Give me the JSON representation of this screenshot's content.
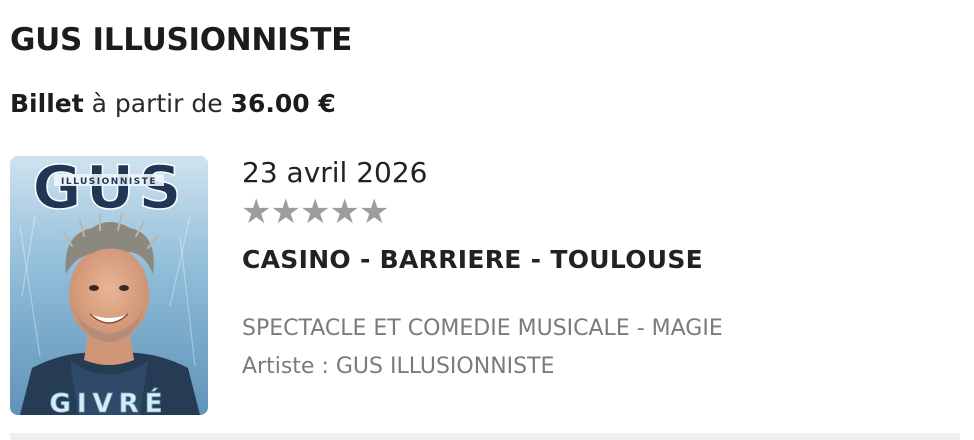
{
  "event": {
    "title": "GUS ILLUSIONNISTE",
    "price": {
      "label_strong": "Billet",
      "label_light": "à partir de",
      "amount": "36.00 €"
    },
    "date": "23 avril 2026",
    "rating": {
      "stars": 5,
      "filled": 0,
      "star_glyph": "★",
      "color": "#9d9d9d"
    },
    "venue": "CASINO - BARRIERE - TOULOUSE",
    "category": "SPECTACLE ET COMEDIE MUSICALE - MAGIE",
    "artist": "Artiste : GUS ILLUSIONNISTE",
    "poster": {
      "top_word": "GUS",
      "subtitle": "ILLUSIONNISTE",
      "bottom_word": "GIVRÉ"
    }
  }
}
